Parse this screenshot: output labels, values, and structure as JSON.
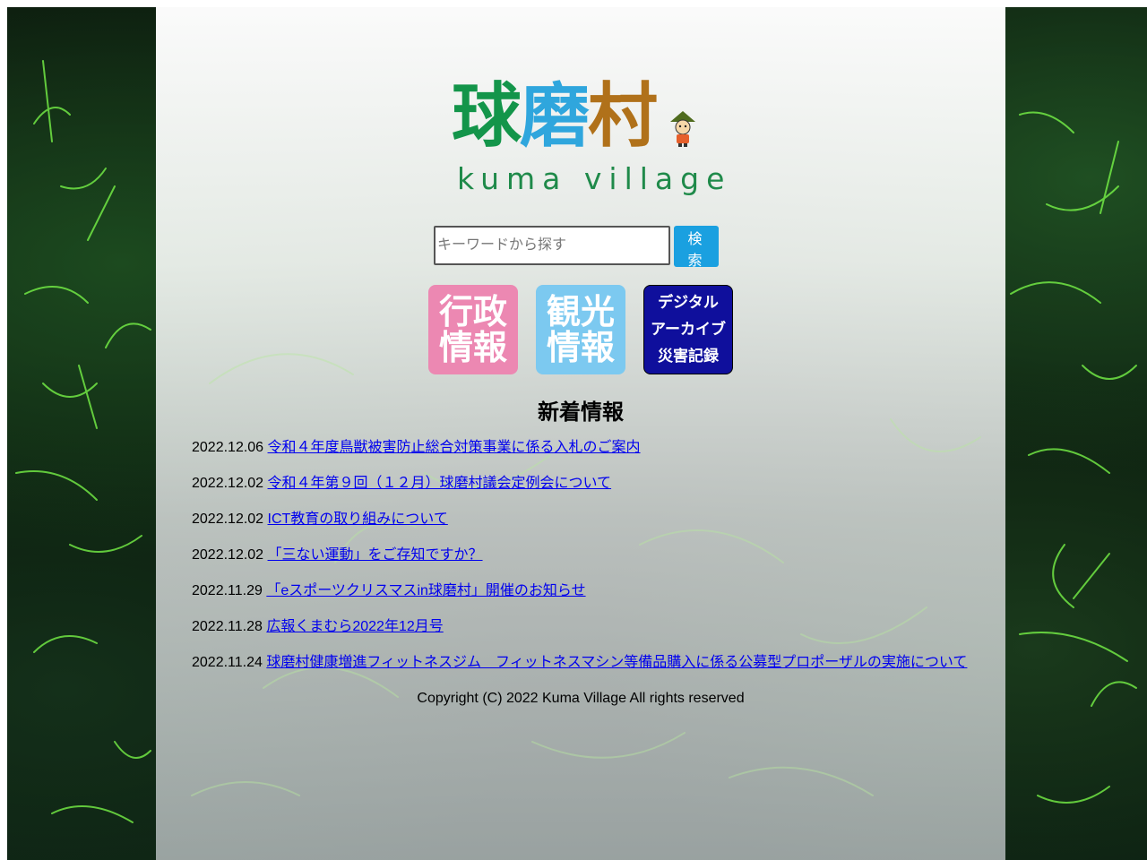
{
  "logo": {
    "kanji_1": "球",
    "kanji_2": "磨",
    "kanji_3": "村",
    "roman": "kuma village"
  },
  "search": {
    "placeholder": "キーワードから探す",
    "button_label": "検 索"
  },
  "tiles": {
    "gyosei": [
      "行政",
      "情報"
    ],
    "kanko": [
      "観光",
      "情報"
    ],
    "digital": [
      "デジタル",
      "アーカイブ",
      "災害記録"
    ]
  },
  "news": {
    "heading": "新着情報",
    "items": [
      {
        "date": "2022.12.06",
        "title": "令和４年度鳥獣被害防止総合対策事業に係る入札のご案内"
      },
      {
        "date": "2022.12.02",
        "title": "令和４年第９回（１２月）球磨村議会定例会について"
      },
      {
        "date": "2022.12.02",
        "title": "ICT教育の取り組みについて"
      },
      {
        "date": "2022.12.02",
        "title": "「三ない運動」をご存知ですか？"
      },
      {
        "date": "2022.11.29",
        "title": "「eスポーツクリスマスin球磨村」開催のお知らせ"
      },
      {
        "date": "2022.11.28",
        "title": "広報くまむら2022年12月号"
      },
      {
        "date": "2022.11.24",
        "title": "球磨村健康増進フィットネスジム　フィットネスマシン等備品購入に係る公募型プロポーザルの実施について"
      }
    ]
  },
  "footer": {
    "copyright": "Copyright (C) 2022 Kuma Village All rights reserved"
  },
  "colors": {
    "logo_green": "#13954a",
    "logo_blue": "#2fa6dd",
    "logo_brown": "#b0711a",
    "search_button": "#1aa0e0",
    "tile_pink": "#ec88b2",
    "tile_light_blue": "#7cc9f0",
    "tile_navy": "#0f0f9c",
    "link": "#0000ee"
  },
  "icons": {
    "mascot": "mascot-character-icon"
  }
}
